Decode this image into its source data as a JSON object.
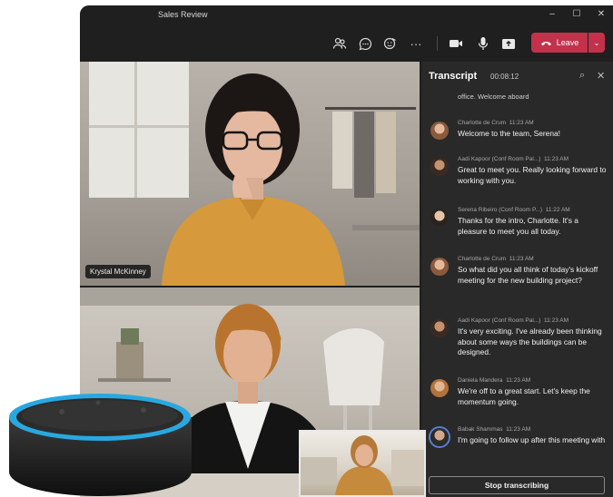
{
  "window": {
    "title": "Sales Review",
    "controls": [
      "–",
      "☐",
      "✕"
    ]
  },
  "toolbar": {
    "icons": [
      "people-icon",
      "chat-icon",
      "reactions-icon",
      "more-icon",
      "camera-icon",
      "mic-icon",
      "share-icon"
    ],
    "more_label": "···",
    "leave_label": "Leave"
  },
  "participants": {
    "top_name": "Krystal McKinney"
  },
  "transcript": {
    "title": "Transcript",
    "timer": "00:08:12",
    "partial_line": "office. Welcome aboard",
    "entries": [
      {
        "speaker": "Charlotte de Crum",
        "time": "11:23 AM",
        "text": "Welcome to the team, Serena!"
      },
      {
        "speaker": "Aadi Kapoor (Conf Room Pal...)",
        "time": "11:23 AM",
        "text": "Great to meet you. Really looking forward to working with you."
      },
      {
        "speaker": "Serena Ribeiro (Conf Room P...)",
        "time": "11:22 AM",
        "text": "Thanks for the intro, Charlotte. It's a pleasure to meet you all today."
      },
      {
        "speaker": "Charlotte de Crum",
        "time": "11:23 AM",
        "text": "So what did you all think of today's kickoff meeting for the new building project?"
      },
      {
        "speaker": "Aadi Kapoor (Conf Room Pal...)",
        "time": "11:23 AM",
        "text": "It's very exciting. I've already been thinking about some ways the buildings can be designed."
      },
      {
        "speaker": "Daniela Mandera",
        "time": "11:23 AM",
        "text": "We're off to a great start. Let's keep the momentum going."
      },
      {
        "speaker": "Babak Shammas",
        "time": "11:23 AM",
        "text": "I'm going to follow up after this meeting with"
      }
    ],
    "stop_label": "Stop transcribing"
  },
  "colors": {
    "accent_red": "#c4314b",
    "panel_bg": "#292929",
    "window_bg": "#1f1f1f",
    "echo_ring": "#29a8e0"
  }
}
